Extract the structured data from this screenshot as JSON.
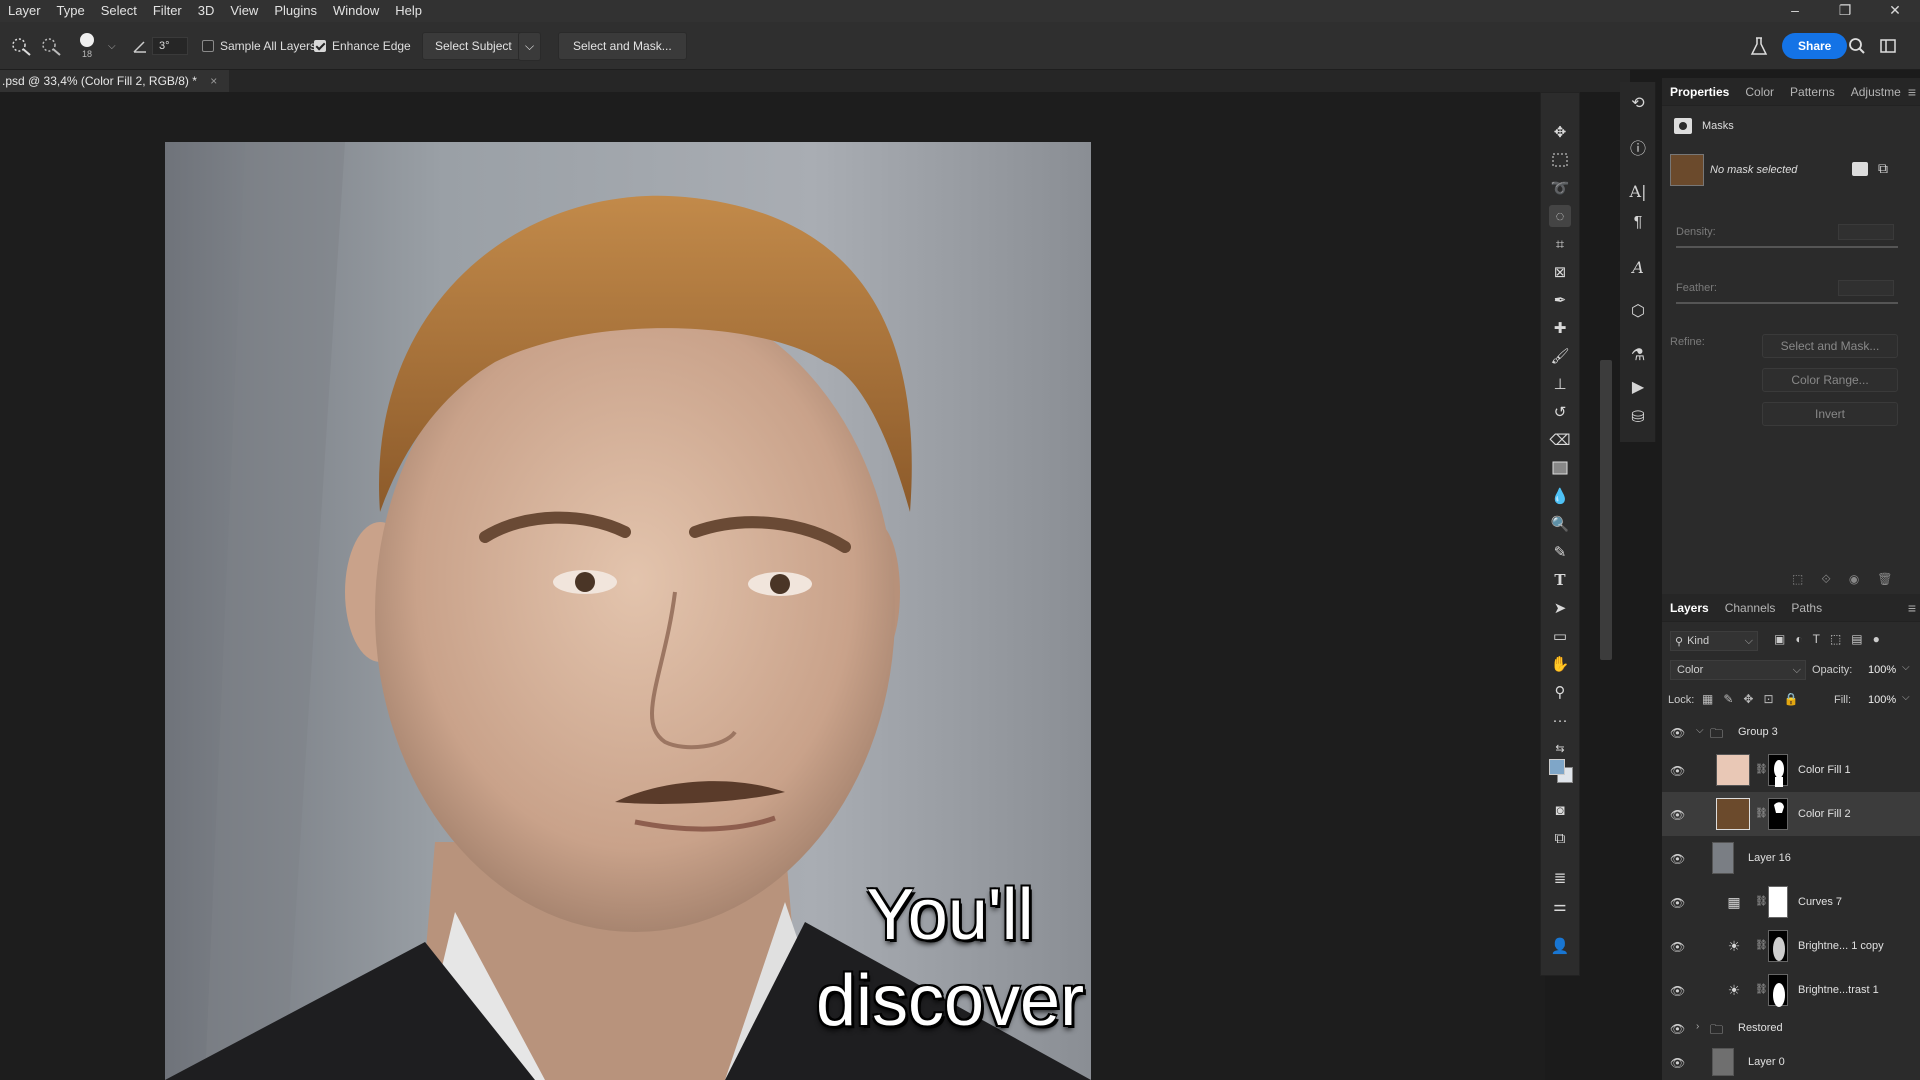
{
  "menu": [
    "Layer",
    "Type",
    "Select",
    "Filter",
    "3D",
    "View",
    "Plugins",
    "Window",
    "Help"
  ],
  "window_controls": [
    "–",
    "❐",
    "✕"
  ],
  "options": {
    "brush_size": "18",
    "angle": "3°",
    "sample_all_layers": "Sample All Layers",
    "enhance_edge": "Enhance Edge",
    "select_subject": "Select Subject",
    "select_and_mask": "Select and Mask...",
    "share": "Share"
  },
  "document_tab": {
    "title": ".psd @ 33,4% (Color Fill 2, RGB/8) *",
    "close": "×"
  },
  "caption": {
    "line1": "You'll",
    "line2": "discover"
  },
  "properties": {
    "tabs": [
      "Properties",
      "Color",
      "Patterns",
      "Adjustme"
    ],
    "section": "Masks",
    "no_mask": "No mask selected",
    "density": "Density:",
    "feather": "Feather:",
    "refine": "Refine:",
    "select_and_mask": "Select and Mask...",
    "color_range": "Color Range...",
    "invert": "Invert"
  },
  "layers_panel": {
    "tabs": [
      "Layers",
      "Channels",
      "Paths"
    ],
    "kind": "Kind",
    "blend_mode": "Color",
    "opacity_label": "Opacity:",
    "opacity": "100%",
    "lock_label": "Lock:",
    "fill_label": "Fill:",
    "fill": "100%",
    "layers": [
      {
        "name": "Group 3"
      },
      {
        "name": "Color Fill 1"
      },
      {
        "name": "Color Fill 2"
      },
      {
        "name": "Layer 16"
      },
      {
        "name": "Curves 7"
      },
      {
        "name": "Brightne... 1 copy"
      },
      {
        "name": "Brightne...trast 1"
      },
      {
        "name": "Restored"
      },
      {
        "name": "Layer 0"
      }
    ]
  },
  "colors": {
    "accent": "#1473e6",
    "fill1_swatch": "#e9c8b6",
    "fill2_swatch": "#6b4a2c",
    "hair": "#b07838"
  }
}
